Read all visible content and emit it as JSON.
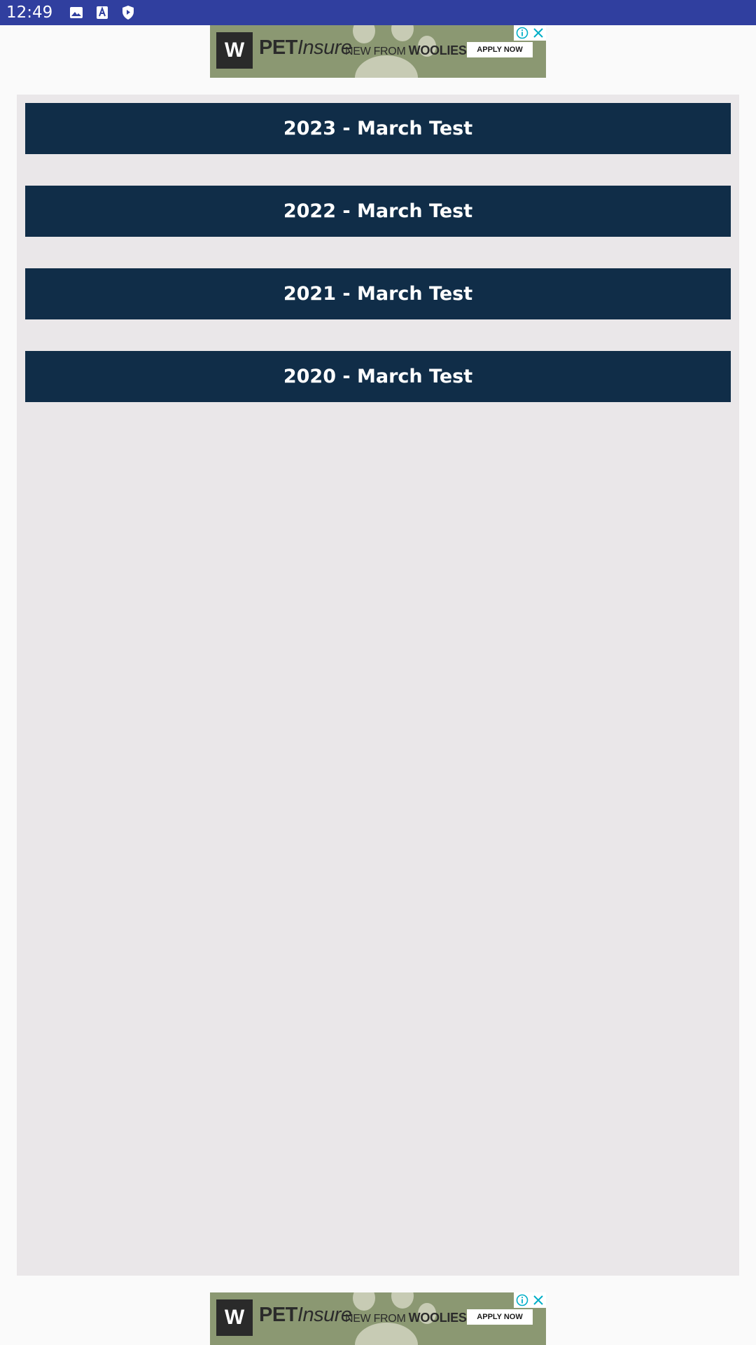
{
  "status_bar": {
    "time": "12:49",
    "icons": [
      "image-icon",
      "text-a-icon",
      "shield-play-icon"
    ]
  },
  "ad": {
    "logo_letter": "W",
    "brand_bold": "PET",
    "brand_italic": "Insure",
    "tagline_prefix": "NEW FROM ",
    "tagline_brand": "WOOLIES",
    "cta": "APPLY NOW"
  },
  "tests": [
    {
      "label": "2023 - March Test"
    },
    {
      "label": "2022 - March Test"
    },
    {
      "label": "2021 - March Test"
    },
    {
      "label": "2020 - March Test"
    }
  ],
  "colors": {
    "status_bar": "#303f9f",
    "button": "#102d48",
    "panel": "#eae7e9",
    "ad_background": "#8b9872",
    "ad_choices_accent": "#00aec7"
  }
}
